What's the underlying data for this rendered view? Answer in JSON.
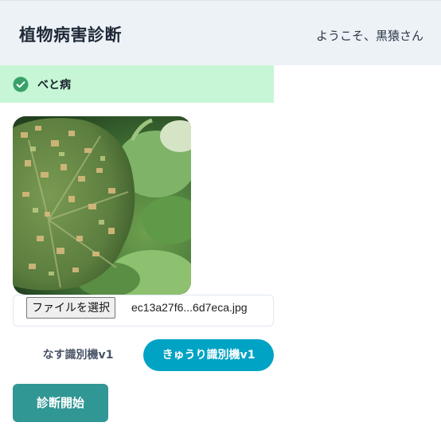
{
  "header": {
    "title": "植物病害診断",
    "welcome": "ようこそ、黒猿さん"
  },
  "result": {
    "label": "べと病",
    "status_color": "#38a169"
  },
  "upload": {
    "button_label": "ファイルを選択",
    "file_name": "ec13a27f6...6d7eca.jpg"
  },
  "models": {
    "options": [
      "なす識別機v1",
      "きゅうり識別機v1"
    ],
    "selected": "きゅうり識別機v1"
  },
  "actions": {
    "start_label": "診断開始"
  },
  "colors": {
    "accent": "#00a3c4",
    "primary": "#319795",
    "success_bg": "#c6f6d5",
    "header_bg": "#edf2f7"
  }
}
